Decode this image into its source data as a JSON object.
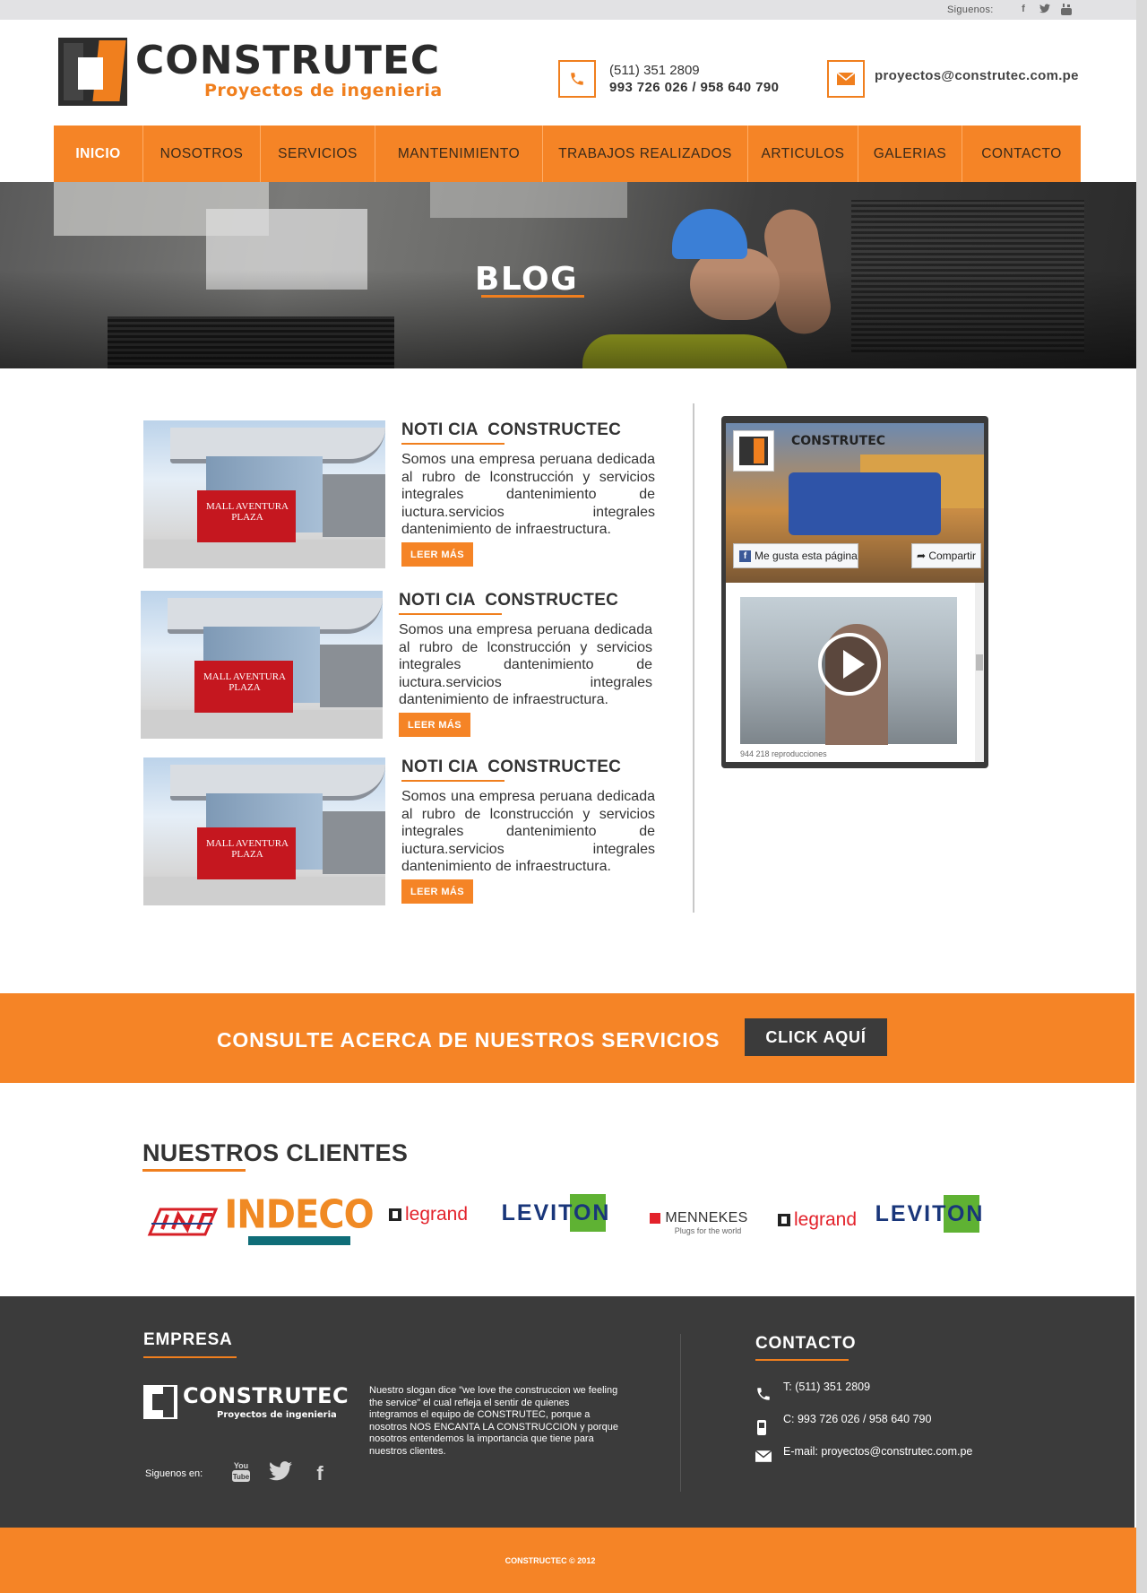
{
  "topbar": {
    "follow_label": "Siguenos:",
    "icons": [
      "facebook-icon",
      "twitter-icon",
      "youtube-icon"
    ]
  },
  "header": {
    "logo_name": "CONSTRUTEC",
    "logo_sub": "Proyectos de ingenieria",
    "phone_line1": "(511) 351 2809",
    "phone_line2": "993 726 026 / 958 640 790",
    "email": "proyectos@construtec.com.pe"
  },
  "nav": {
    "items": [
      {
        "label": "INICIO",
        "active": true
      },
      {
        "label": "NOSOTROS"
      },
      {
        "label": "SERVICIOS"
      },
      {
        "label": "MANTENIMIENTO"
      },
      {
        "label": "TRABAJOS REALIZADOS"
      },
      {
        "label": "ARTICULOS"
      },
      {
        "label": "GALERIAS"
      },
      {
        "label": "CONTACTO"
      }
    ]
  },
  "hero": {
    "title": "BLOG"
  },
  "posts": [
    {
      "title": "NOTI CIA  CONSTRUCTEC",
      "body": "Somos una empresa peruana dedicada al rubro de lconstrucción y servicios integrales dantenimiento de iuctura.servicios integrales dantenimiento de infraestructura.",
      "button": "LEER MÁS",
      "image_sign": "MALL AVENTURA PLAZA"
    },
    {
      "title": "NOTI CIA  CONSTRUCTEC",
      "body": "Somos una empresa peruana dedicada al rubro de lconstrucción y servicios integrales dantenimiento de iuctura.servicios integrales dantenimiento de infraestructura.",
      "button": "LEER MÁS",
      "image_sign": "MALL AVENTURA PLAZA"
    },
    {
      "title": "NOTI CIA  CONSTRUCTEC",
      "body": "Somos una empresa peruana dedicada al rubro de lconstrucción y servicios integrales dantenimiento de iuctura.servicios integrales dantenimiento de infraestructura.",
      "button": "LEER MÁS",
      "image_sign": "MALL AVENTURA PLAZA"
    }
  ],
  "fb_widget": {
    "page_name": "CONSTRUTEC",
    "like_label": "Me gusta esta página",
    "share_label": "Compartir",
    "views": "944 218 reproducciones"
  },
  "consult": {
    "text": "CONSULTE ACERCA DE NUESTROS SERVICIOS",
    "button": "CLICK AQUÍ"
  },
  "clients": {
    "title": "NUESTROS CLIENTES",
    "logos": [
      "INDECO",
      "legrand",
      "LEVITON",
      "MENNEKES",
      "Plugs for the world",
      "legrand",
      "LEVITON"
    ],
    "colors": {
      "indeco_orange": "#f08a24",
      "indeco_teal": "#0f6d78",
      "legrand_red": "#e3222b",
      "leviton_blue": "#19367a",
      "leviton_green": "#5fb233"
    }
  },
  "footer": {
    "empresa_title": "EMPRESA",
    "logo_name": "CONSTRUTEC",
    "logo_sub": "Proyectos de ingenieria",
    "slogan": "Nuestro slogan dice \"we love the construccion we feeling the service\" el cual refleja el sentir de quienes integramos el equipo de CONSTRUTEC, porque a nosotros NOS ENCANTA LA CONSTRUCCION y porque nosotros entendemos la importancia que tiene para nuestros clientes.",
    "follow_label": "Siguenos en:",
    "contact_title": "CONTACTO",
    "phone": "T: (511) 351 2809",
    "cell": "C: 993 726 026 / 958 640 790",
    "email": "E-mail: proyectos@construtec.com.pe",
    "copyright": "CONSTRUCTEC © 2012"
  },
  "colors": {
    "accent": "#f58426",
    "dark": "#3b3b3b"
  }
}
